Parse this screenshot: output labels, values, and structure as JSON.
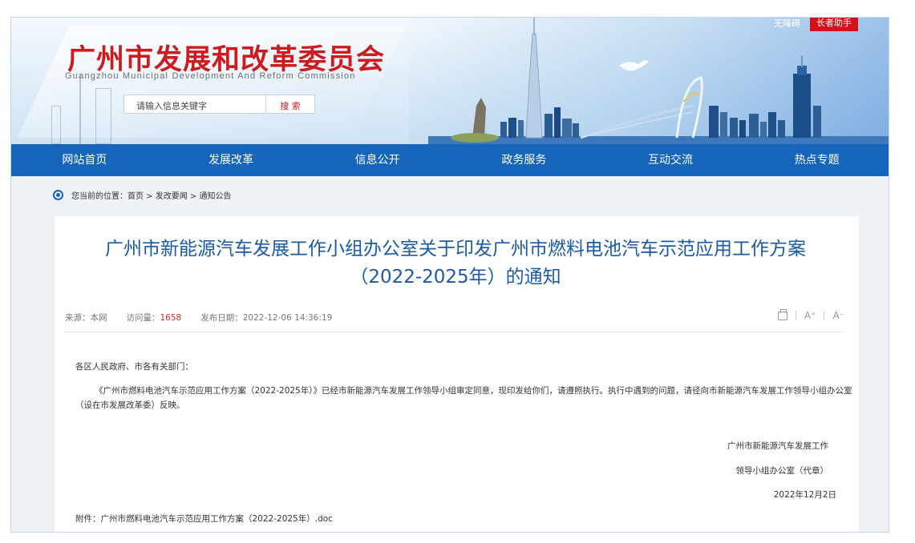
{
  "header": {
    "title": "广州市发展和改革委员会",
    "subtitle": "Guangzhou Municipal Development And Reform Commission",
    "search": {
      "placeholder": "请输入信息关键字",
      "button": "搜 索"
    },
    "accessibility": "无障碍",
    "elder_mode": "长者助手"
  },
  "nav": {
    "items": [
      "网站首页",
      "发展改革",
      "信息公开",
      "政务服务",
      "互动交流",
      "热点专题"
    ]
  },
  "breadcrumb": {
    "text": "您当前的位置：首页 > 发改要闻 > 通知公告"
  },
  "article": {
    "title_line1": "广州市新能源汽车发展工作小组办公室关于印发广州市燃料电池汽车示范应用工作方案",
    "title_line2": "（2022-2025年）的通知",
    "meta": {
      "source_label": "来源：本网",
      "views_label": "访问量：",
      "views": "1658",
      "date_label": "发布日期：2022-12-06 14:36:19"
    },
    "tools": {
      "font_up": "A⁺",
      "font_down": "A⁻"
    },
    "salutation": "各区人民政府、市各有关部门：",
    "paragraph": "《广州市燃料电池汽车示范应用工作方案（2022-2025年）》已经市新能源汽车发展工作领导小组审定同意，现印发给你们，请遵照执行。执行中遇到的问题，请径向市新能源汽车发展工作领导小组办公室（设在市发展改革委）反映。",
    "signature_line1": "广州市新能源汽车发展工作",
    "signature_line2": "领导小组办公室（代章）",
    "signature_date": "2022年12月2日",
    "attachment": "附件：广州市燃料电池汽车示范应用工作方案（2022-2025年）.doc"
  }
}
